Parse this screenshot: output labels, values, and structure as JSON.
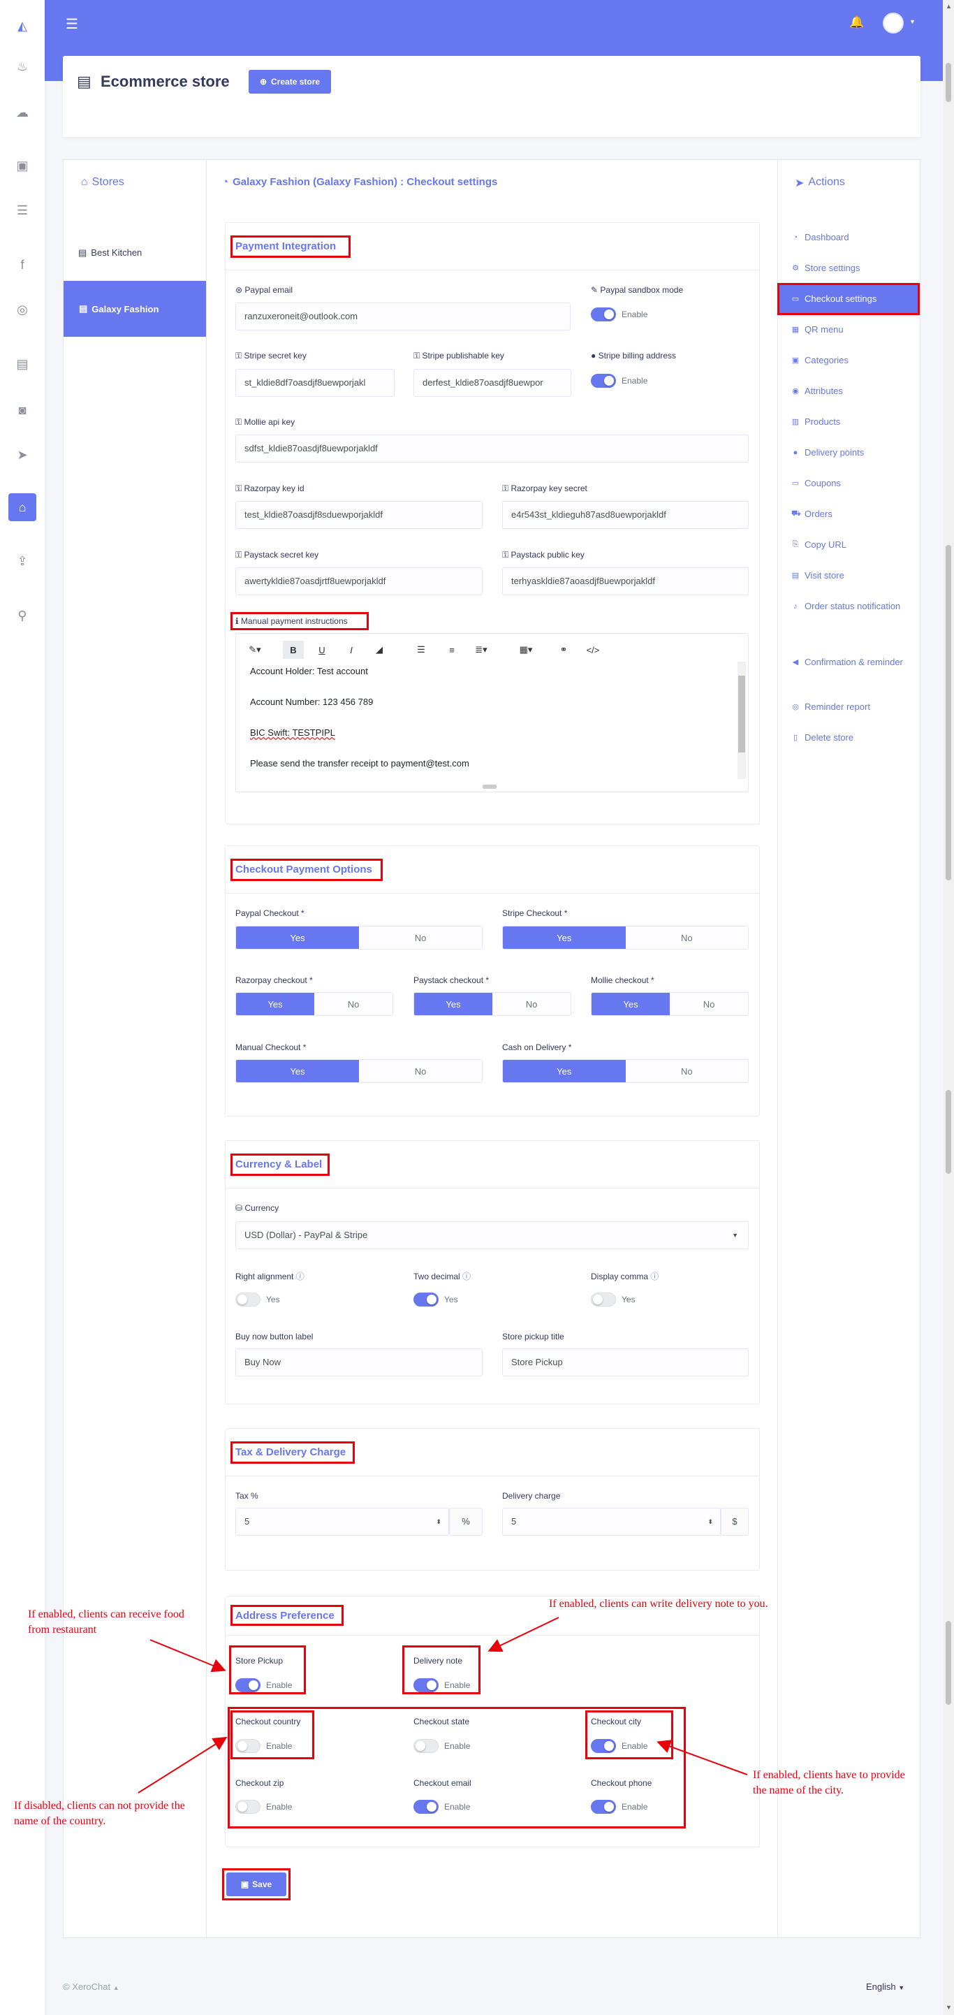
{
  "sidebar": {
    "icons": [
      "logo-icon",
      "fire-icon",
      "cloud-download-icon",
      "tv-icon",
      "database-icon",
      "facebook-icon",
      "instagram-icon",
      "contact-book-icon",
      "robot-icon",
      "paper-plane-icon",
      "store-icon",
      "share-icon",
      "search-icon"
    ]
  },
  "header": {
    "title": "Ecommerce store",
    "create_button": "Create store"
  },
  "stores": {
    "title": "Stores",
    "items": [
      "Best Kitchen",
      "Galaxy Fashion"
    ]
  },
  "main": {
    "title": "Galaxy Fashion (Galaxy Fashion) : Checkout settings"
  },
  "actions": {
    "title": "Actions",
    "items": [
      "Dashboard",
      "Store settings",
      "Checkout settings",
      "QR menu",
      "Categories",
      "Attributes",
      "Products",
      "Delivery points",
      "Coupons",
      "Orders",
      "Copy URL",
      "Visit store",
      "Order status notification",
      "Confirmation & reminder",
      "Reminder report",
      "Delete store"
    ]
  },
  "payment": {
    "title": "Payment Integration",
    "paypal_email_label": "Paypal email",
    "paypal_email": "ranzuxeroneit@outlook.com",
    "sandbox_label": "Paypal sandbox mode",
    "enable": "Enable",
    "stripe_secret_label": "Stripe secret key",
    "stripe_secret": "st_kldie8df7oasdjf8uewporjakl",
    "stripe_pub_label": "Stripe publishable key",
    "stripe_pub": "derfest_kldie87oasdjf8uewpor",
    "stripe_billing_label": "Stripe billing address",
    "mollie_label": "Mollie api key",
    "mollie": "sdfst_kldie87oasdjf8uewporjakldf",
    "razorpay_id_label": "Razorpay key id",
    "razorpay_id": "test_kldie87oasdjf8sduewporjakldf",
    "razorpay_secret_label": "Razorpay key secret",
    "razorpay_secret": "e4r543st_kldieguh87asd8uewporjakldf",
    "paystack_secret_label": "Paystack secret key",
    "paystack_secret": "awertykldie87oasdjrtf8uewporjakldf",
    "paystack_public_label": "Paystack public key",
    "paystack_public": "terhyaskldie87aoasdjf8uewporjakldf",
    "manual_label": "Manual payment instructions",
    "manual_lines": [
      "Account Holder: Test account",
      "Account Number: 123 456 789",
      "BIC Swift: TESTPIPL",
      "Please send the transfer receipt to payment@test.com"
    ]
  },
  "checkout": {
    "title": "Checkout Payment Options",
    "yes": "Yes",
    "no": "No",
    "paypal": "Paypal Checkout *",
    "stripe": "Stripe Checkout *",
    "razorpay": "Razorpay checkout *",
    "paystack": "Paystack checkout *",
    "mollie": "Mollie checkout *",
    "manual": "Manual Checkout *",
    "cod": "Cash on Delivery *"
  },
  "currency": {
    "title": "Currency & Label",
    "currency_label": "Currency",
    "currency_value": "USD (Dollar) - PayPal & Stripe",
    "right_align": "Right alignment",
    "two_decimal": "Two decimal",
    "display_comma": "Display comma",
    "yes": "Yes",
    "buy_now_label": "Buy now button label",
    "buy_now": "Buy Now",
    "pickup_title_label": "Store pickup title",
    "pickup_title": "Store Pickup"
  },
  "tax": {
    "title": "Tax & Delivery Charge",
    "tax_label": "Tax %",
    "tax_value": "5",
    "tax_unit": "%",
    "delivery_label": "Delivery charge",
    "delivery_value": "5",
    "delivery_unit": "$"
  },
  "address": {
    "title": "Address Preference",
    "enable": "Enable",
    "store_pickup": "Store Pickup",
    "delivery_note": "Delivery note",
    "country": "Checkout country",
    "state": "Checkout state",
    "city": "Checkout city",
    "zip": "Checkout zip",
    "email": "Checkout email",
    "phone": "Checkout phone"
  },
  "save_button": "Save",
  "annotations": {
    "a1": "If enabled, clients can receive food from restaurant",
    "a2": "If enabled, clients can write delivery note to you.",
    "a3": "If disabled, clients can not provide the name of the country.",
    "a4": "If enabled, clients have to provide the name of the city."
  },
  "footer": {
    "copyright": "© XeroChat",
    "language": "English"
  },
  "colors": {
    "primary": "#6777ef",
    "annotation": "#e8000b"
  }
}
